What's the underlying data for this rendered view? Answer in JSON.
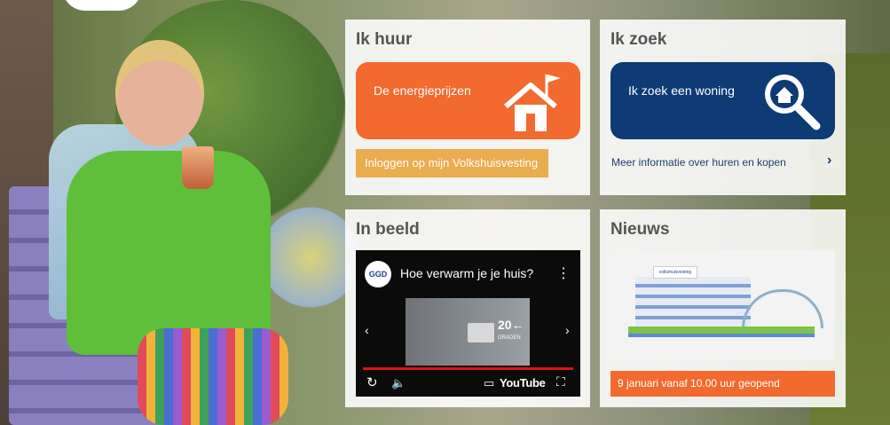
{
  "panels": {
    "huur": {
      "title": "Ik huur",
      "tile_label": "De energieprijzen",
      "login_label": "Inloggen op mijn Volkshuisvesting"
    },
    "zoek": {
      "title": "Ik zoek",
      "tile_label": "Ik zoek een woning",
      "info_link": "Meer informatie over huren en kopen",
      "info_chevron": "›"
    },
    "beeld": {
      "title": "In beeld",
      "video": {
        "channel_logo": "GGD",
        "title": "Hoe verwarm je je huis?",
        "menu": "⋮",
        "thermostat_value": "20←",
        "thermostat_unit": "GRADEN",
        "prev": "‹",
        "next": "›",
        "replay": "↻",
        "volume": "🔈",
        "captions": "▭",
        "brand": "YouTube",
        "fullscreen": "⛶"
      }
    },
    "nieuws": {
      "title": "Nieuws",
      "image_sign": "volkshuisvesting",
      "headline": "9 januari vanaf 10.00 uur geopend"
    }
  },
  "colors": {
    "orange": "#f26a2e",
    "navy": "#0e3a75",
    "gold": "#e9ac4f",
    "panel_bg": "#ffffff"
  }
}
